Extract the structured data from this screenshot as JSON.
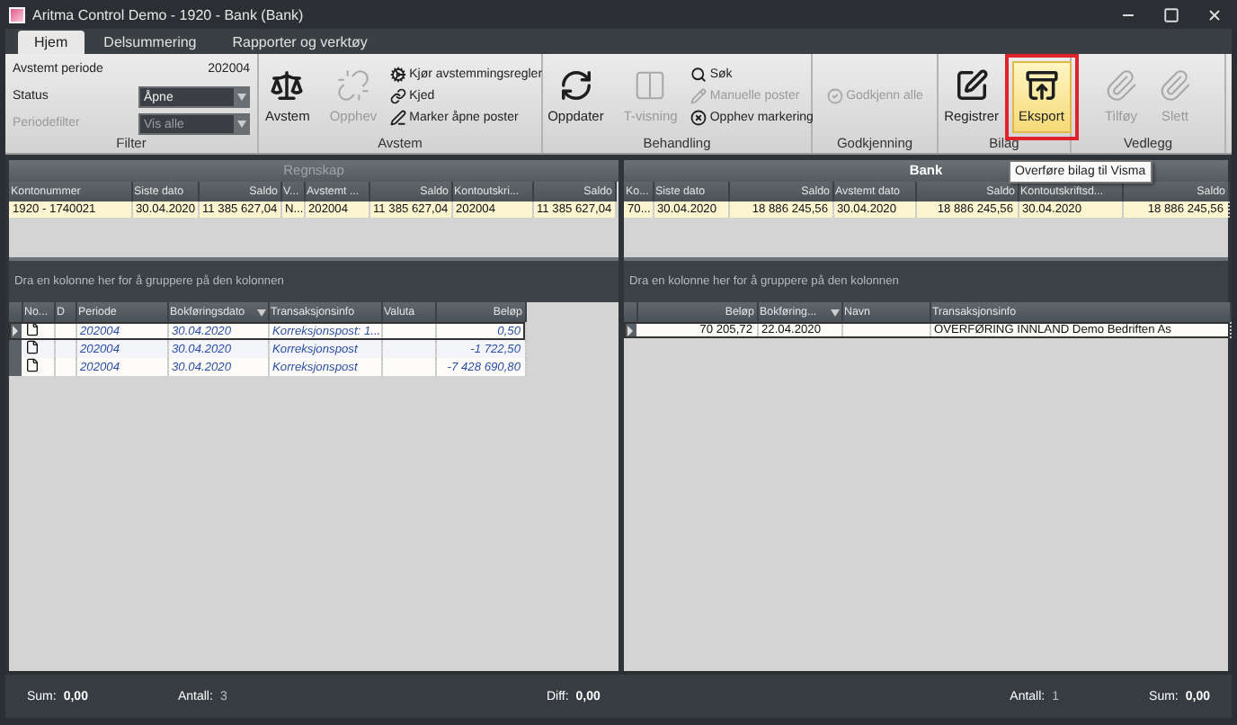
{
  "window": {
    "title": "Aritma Control Demo - 1920 - Bank (Bank)"
  },
  "tabs": [
    {
      "label": "Hjem",
      "selected": true
    },
    {
      "label": "Delsummering",
      "selected": false
    },
    {
      "label": "Rapporter og verktøy",
      "selected": false
    }
  ],
  "ribbon": {
    "groups": [
      {
        "label": "Filter",
        "kind": "filter",
        "fields": [
          {
            "label": "Avstemt periode",
            "value": "202004",
            "kind": "text",
            "disabled": false
          },
          {
            "label": "Status",
            "value": "Åpne",
            "kind": "select",
            "disabled": false
          },
          {
            "label": "Periodefilter",
            "value": "Vis alle",
            "kind": "select",
            "disabled": true
          }
        ]
      },
      {
        "label": "Avstem",
        "kind": "buttons",
        "items": [
          {
            "kind": "large",
            "label": "Avstem",
            "disabled": false,
            "highlighted": false
          },
          {
            "kind": "large",
            "label": "Opphev",
            "disabled": true,
            "highlighted": false
          },
          {
            "kind": "stack",
            "items": [
              {
                "label": "Kjør avstemmingsregler",
                "disabled": false
              },
              {
                "label": "Kjed",
                "disabled": false
              },
              {
                "label": "Marker åpne poster",
                "disabled": false
              }
            ]
          }
        ]
      },
      {
        "label": "Behandling",
        "kind": "buttons",
        "items": [
          {
            "kind": "large",
            "label": "Oppdater",
            "disabled": false,
            "highlighted": false
          },
          {
            "kind": "large",
            "label": "T-visning",
            "disabled": true,
            "highlighted": false
          },
          {
            "kind": "stack",
            "items": [
              {
                "label": "Søk",
                "disabled": false
              },
              {
                "label": "Manuelle poster",
                "disabled": true
              },
              {
                "label": "Opphev markering",
                "disabled": false
              }
            ]
          }
        ]
      },
      {
        "label": "Godkjenning",
        "kind": "buttons",
        "items": [
          {
            "kind": "stack",
            "items": [
              {
                "label": "Godkjenn alle",
                "disabled": true
              }
            ]
          }
        ]
      },
      {
        "label": "Bilag",
        "kind": "buttons",
        "items": [
          {
            "kind": "large",
            "label": "Registrer",
            "disabled": false,
            "highlighted": false
          },
          {
            "kind": "large",
            "label": "Eksport",
            "disabled": false,
            "highlighted": true,
            "tooltip": "Overføre bilag til Visma"
          }
        ]
      },
      {
        "label": "Vedlegg",
        "kind": "buttons",
        "items": [
          {
            "kind": "large",
            "label": "Tilføy",
            "disabled": true,
            "highlighted": false
          },
          {
            "kind": "large",
            "label": "Slett",
            "disabled": true,
            "highlighted": false
          }
        ]
      }
    ]
  },
  "panels": [
    {
      "summary": {
        "title": "Regnskap",
        "active": false,
        "columns": [
          {
            "label": "Kontonummer",
            "kind": "text"
          },
          {
            "label": "Siste dato",
            "kind": "text"
          },
          {
            "label": "Saldo",
            "kind": "amount"
          },
          {
            "label": "V...",
            "kind": "text"
          },
          {
            "label": "Avstemt ...",
            "kind": "text"
          },
          {
            "label": "Saldo",
            "kind": "amount"
          },
          {
            "label": "Kontoutskri...",
            "kind": "text"
          },
          {
            "label": "Saldo",
            "kind": "amount"
          }
        ],
        "rows": [
          {
            "selected": true,
            "cells": [
              "1920 - 1740021",
              "30.04.2020",
              "11 385 627,04",
              "N...",
              "202004",
              "11 385 627,04",
              "202004",
              "11 385 627,04"
            ]
          }
        ]
      },
      "group_hint": "Dra en kolonne her for å gruppere på den kolonnen",
      "transactions": {
        "columns": [
          {
            "label": "No...",
            "kind": "document"
          },
          {
            "label": "D",
            "kind": "text"
          },
          {
            "label": "Periode",
            "kind": "text"
          },
          {
            "label": "Bokføringsdato",
            "kind": "text"
          },
          {
            "label": "Transaksjonsinfo",
            "kind": "text"
          },
          {
            "label": "Valuta",
            "kind": "text"
          },
          {
            "label": "Beløp",
            "kind": "amount"
          }
        ],
        "rows": [
          {
            "current": true,
            "kind": "correction",
            "document": true,
            "cells": [
              null,
              null,
              "202004",
              "30.04.2020",
              "Korreksjonspost: 1...",
              null,
              "0,50"
            ]
          },
          {
            "current": false,
            "kind": "correction",
            "document": true,
            "cells": [
              null,
              null,
              "202004",
              "30.04.2020",
              "Korreksjonspost",
              null,
              "-1 722,50"
            ]
          },
          {
            "current": false,
            "kind": "correction",
            "document": true,
            "cells": [
              null,
              null,
              "202004",
              "30.04.2020",
              "Korreksjonspost",
              null,
              "-7 428 690,80"
            ]
          }
        ]
      },
      "status": {
        "left": [
          {
            "label": "Sum:",
            "value": "0,00"
          },
          {
            "label": "Antall:",
            "value": "3"
          }
        ],
        "right": [
          {
            "label": "Diff:",
            "value": "0,00"
          }
        ]
      }
    },
    {
      "summary": {
        "title": "Bank",
        "active": true,
        "columns": [
          {
            "label": "Ko...",
            "kind": "text"
          },
          {
            "label": "Siste dato",
            "kind": "text"
          },
          {
            "label": "Saldo",
            "kind": "amount"
          },
          {
            "label": "Avstemt dato",
            "kind": "text"
          },
          {
            "label": "Saldo",
            "kind": "amount"
          },
          {
            "label": "Kontoutskriftsd...",
            "kind": "text"
          },
          {
            "label": "Saldo",
            "kind": "amount"
          }
        ],
        "rows": [
          {
            "selected": true,
            "cells": [
              "70...",
              "30.04.2020",
              "18 886 245,56",
              "30.04.2020",
              "18 886 245,56",
              "30.04.2020",
              "18 886 245,56"
            ]
          }
        ]
      },
      "group_hint": "Dra en kolonne her for å gruppere på den kolonnen",
      "transactions": {
        "columns": [
          {
            "label": "Beløp",
            "kind": "amount"
          },
          {
            "label": "Bokføring...",
            "kind": "text"
          },
          {
            "label": "Navn",
            "kind": "text"
          },
          {
            "label": "Transaksjonsinfo",
            "kind": "text"
          }
        ],
        "rows": [
          {
            "current": true,
            "kind": "bank",
            "cells": [
              "70 205,72",
              "22.04.2020",
              null,
              "OVERFØRING INNLAND Demo Bedriften As"
            ]
          }
        ]
      },
      "status": {
        "right": [
          {
            "label": "Antall:",
            "value": "1"
          },
          {
            "label": "Sum:",
            "value": "0,00"
          }
        ]
      }
    }
  ]
}
